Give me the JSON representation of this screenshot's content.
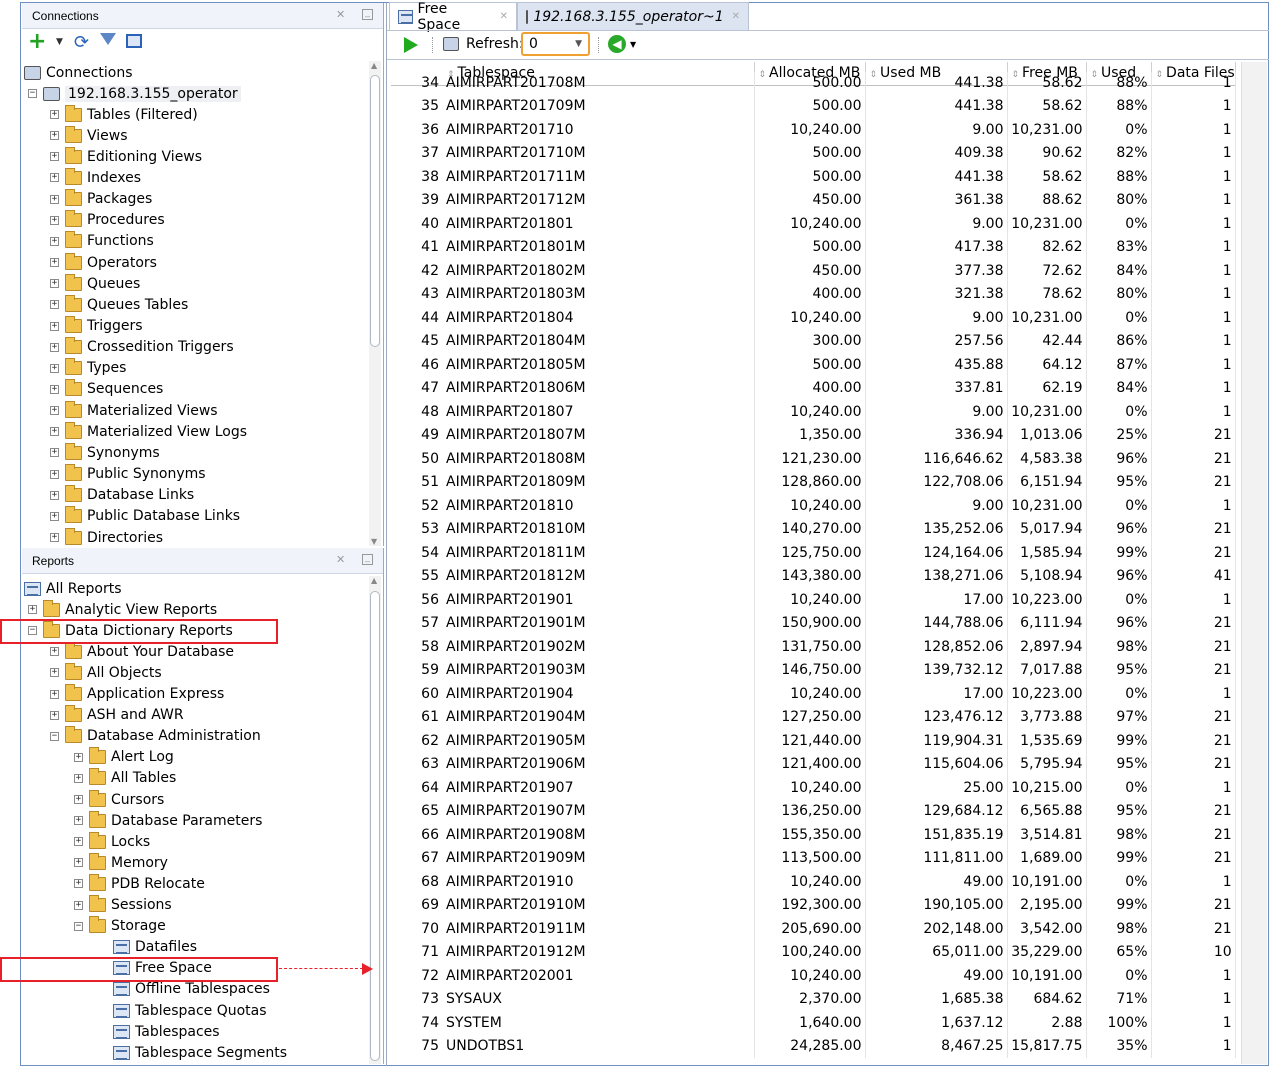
{
  "connections_panel": {
    "title": "Connections",
    "root_label": "Connections",
    "connection_label": "192.168.3.155_operator",
    "items": [
      "Tables (Filtered)",
      "Views",
      "Editioning Views",
      "Indexes",
      "Packages",
      "Procedures",
      "Functions",
      "Operators",
      "Queues",
      "Queues Tables",
      "Triggers",
      "Crossedition Triggers",
      "Types",
      "Sequences",
      "Materialized Views",
      "Materialized View Logs",
      "Synonyms",
      "Public Synonyms",
      "Database Links",
      "Public Database Links",
      "Directories"
    ]
  },
  "reports_panel": {
    "title": "Reports",
    "all_reports": "All Reports",
    "analytic": "Analytic View Reports",
    "data_dictionary": "Data Dictionary Reports",
    "dd_children": [
      "About Your Database",
      "All Objects",
      "Application Express",
      "ASH and AWR",
      "Database Administration"
    ],
    "admin_children": [
      "Alert Log",
      "All Tables",
      "Cursors",
      "Database Parameters",
      "Locks",
      "Memory",
      "PDB Relocate",
      "Sessions",
      "Storage"
    ],
    "storage_children": [
      "Datafiles",
      "Free Space",
      "Offline Tablespaces",
      "Tablespace Quotas",
      "Tablespaces",
      "Tablespace Segments"
    ]
  },
  "tabs": [
    {
      "label": "Free Space"
    },
    {
      "label": "192.168.3.155_operator~1"
    }
  ],
  "toolbar": {
    "refresh_label": "Refresh:",
    "refresh_value": "0"
  },
  "grid": {
    "columns": [
      "Tablespace",
      "Allocated MB",
      "Used MB",
      "Free MB",
      "Used",
      "Data Files"
    ],
    "rows": [
      [
        "34",
        "AIMIRPART201708M",
        "500.00",
        "441.38",
        "58.62",
        "88%",
        "1"
      ],
      [
        "35",
        "AIMIRPART201709M",
        "500.00",
        "441.38",
        "58.62",
        "88%",
        "1"
      ],
      [
        "36",
        "AIMIRPART201710",
        "10,240.00",
        "9.00",
        "10,231.00",
        "0%",
        "1"
      ],
      [
        "37",
        "AIMIRPART201710M",
        "500.00",
        "409.38",
        "90.62",
        "82%",
        "1"
      ],
      [
        "38",
        "AIMIRPART201711M",
        "500.00",
        "441.38",
        "58.62",
        "88%",
        "1"
      ],
      [
        "39",
        "AIMIRPART201712M",
        "450.00",
        "361.38",
        "88.62",
        "80%",
        "1"
      ],
      [
        "40",
        "AIMIRPART201801",
        "10,240.00",
        "9.00",
        "10,231.00",
        "0%",
        "1"
      ],
      [
        "41",
        "AIMIRPART201801M",
        "500.00",
        "417.38",
        "82.62",
        "83%",
        "1"
      ],
      [
        "42",
        "AIMIRPART201802M",
        "450.00",
        "377.38",
        "72.62",
        "84%",
        "1"
      ],
      [
        "43",
        "AIMIRPART201803M",
        "400.00",
        "321.38",
        "78.62",
        "80%",
        "1"
      ],
      [
        "44",
        "AIMIRPART201804",
        "10,240.00",
        "9.00",
        "10,231.00",
        "0%",
        "1"
      ],
      [
        "45",
        "AIMIRPART201804M",
        "300.00",
        "257.56",
        "42.44",
        "86%",
        "1"
      ],
      [
        "46",
        "AIMIRPART201805M",
        "500.00",
        "435.88",
        "64.12",
        "87%",
        "1"
      ],
      [
        "47",
        "AIMIRPART201806M",
        "400.00",
        "337.81",
        "62.19",
        "84%",
        "1"
      ],
      [
        "48",
        "AIMIRPART201807",
        "10,240.00",
        "9.00",
        "10,231.00",
        "0%",
        "1"
      ],
      [
        "49",
        "AIMIRPART201807M",
        "1,350.00",
        "336.94",
        "1,013.06",
        "25%",
        "21"
      ],
      [
        "50",
        "AIMIRPART201808M",
        "121,230.00",
        "116,646.62",
        "4,583.38",
        "96%",
        "21"
      ],
      [
        "51",
        "AIMIRPART201809M",
        "128,860.00",
        "122,708.06",
        "6,151.94",
        "95%",
        "21"
      ],
      [
        "52",
        "AIMIRPART201810",
        "10,240.00",
        "9.00",
        "10,231.00",
        "0%",
        "1"
      ],
      [
        "53",
        "AIMIRPART201810M",
        "140,270.00",
        "135,252.06",
        "5,017.94",
        "96%",
        "21"
      ],
      [
        "54",
        "AIMIRPART201811M",
        "125,750.00",
        "124,164.06",
        "1,585.94",
        "99%",
        "21"
      ],
      [
        "55",
        "AIMIRPART201812M",
        "143,380.00",
        "138,271.06",
        "5,108.94",
        "96%",
        "41"
      ],
      [
        "56",
        "AIMIRPART201901",
        "10,240.00",
        "17.00",
        "10,223.00",
        "0%",
        "1"
      ],
      [
        "57",
        "AIMIRPART201901M",
        "150,900.00",
        "144,788.06",
        "6,111.94",
        "96%",
        "21"
      ],
      [
        "58",
        "AIMIRPART201902M",
        "131,750.00",
        "128,852.06",
        "2,897.94",
        "98%",
        "21"
      ],
      [
        "59",
        "AIMIRPART201903M",
        "146,750.00",
        "139,732.12",
        "7,017.88",
        "95%",
        "21"
      ],
      [
        "60",
        "AIMIRPART201904",
        "10,240.00",
        "17.00",
        "10,223.00",
        "0%",
        "1"
      ],
      [
        "61",
        "AIMIRPART201904M",
        "127,250.00",
        "123,476.12",
        "3,773.88",
        "97%",
        "21"
      ],
      [
        "62",
        "AIMIRPART201905M",
        "121,440.00",
        "119,904.31",
        "1,535.69",
        "99%",
        "21"
      ],
      [
        "63",
        "AIMIRPART201906M",
        "121,400.00",
        "115,604.06",
        "5,795.94",
        "95%",
        "21"
      ],
      [
        "64",
        "AIMIRPART201907",
        "10,240.00",
        "25.00",
        "10,215.00",
        "0%",
        "1"
      ],
      [
        "65",
        "AIMIRPART201907M",
        "136,250.00",
        "129,684.12",
        "6,565.88",
        "95%",
        "21"
      ],
      [
        "66",
        "AIMIRPART201908M",
        "155,350.00",
        "151,835.19",
        "3,514.81",
        "98%",
        "21"
      ],
      [
        "67",
        "AIMIRPART201909M",
        "113,500.00",
        "111,811.00",
        "1,689.00",
        "99%",
        "21"
      ],
      [
        "68",
        "AIMIRPART201910",
        "10,240.00",
        "49.00",
        "10,191.00",
        "0%",
        "1"
      ],
      [
        "69",
        "AIMIRPART201910M",
        "192,300.00",
        "190,105.00",
        "2,195.00",
        "99%",
        "21"
      ],
      [
        "70",
        "AIMIRPART201911M",
        "205,690.00",
        "202,148.00",
        "3,542.00",
        "98%",
        "21"
      ],
      [
        "71",
        "AIMIRPART201912M",
        "100,240.00",
        "65,011.00",
        "35,229.00",
        "65%",
        "10"
      ],
      [
        "72",
        "AIMIRPART202001",
        "10,240.00",
        "49.00",
        "10,191.00",
        "0%",
        "1"
      ],
      [
        "73",
        "SYSAUX",
        "2,370.00",
        "1,685.38",
        "684.62",
        "71%",
        "1"
      ],
      [
        "74",
        "SYSTEM",
        "1,640.00",
        "1,637.12",
        "2.88",
        "100%",
        "1"
      ],
      [
        "75",
        "UNDOTBS1",
        "24,285.00",
        "8,467.25",
        "15,817.75",
        "35%",
        "1"
      ]
    ]
  }
}
